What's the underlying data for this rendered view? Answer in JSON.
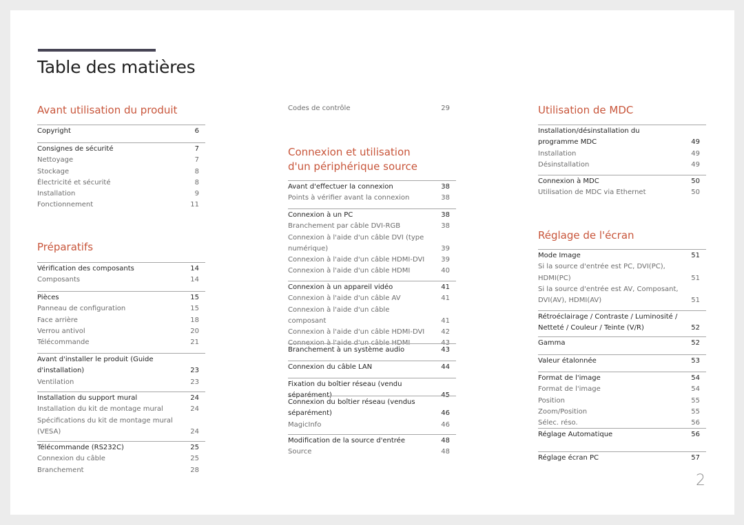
{
  "document": {
    "title": "Table des matières",
    "page_number": "2",
    "colors": {
      "heading": "#c8553a",
      "title_bar": "#464454",
      "main_text": "#1f1f1f",
      "sub_text": "#6b6b6b"
    }
  },
  "columns": [
    {
      "sections": [
        {
          "heading": "Avant utilisation du produit",
          "groups": [
            {
              "entries": [
                {
                  "label": "Copyright",
                  "page": "6",
                  "main": true
                }
              ]
            },
            {
              "entries": [
                {
                  "label": "Consignes de sécurité",
                  "page": "7",
                  "main": true
                },
                {
                  "label": "Nettoyage",
                  "page": "7"
                },
                {
                  "label": "Stockage",
                  "page": "8"
                },
                {
                  "label": "Électricité et sécurité",
                  "page": "8"
                },
                {
                  "label": "Installation",
                  "page": "9"
                },
                {
                  "label": "Fonctionnement",
                  "page": "11"
                }
              ]
            }
          ]
        },
        {
          "heading": "Préparatifs",
          "groups": [
            {
              "entries": [
                {
                  "label": "Vérification des composants",
                  "page": "14",
                  "main": true
                },
                {
                  "label": "Composants",
                  "page": "14"
                }
              ]
            },
            {
              "entries": [
                {
                  "label": "Pièces",
                  "page": "15",
                  "main": true
                },
                {
                  "label": "Panneau de configuration",
                  "page": "15"
                },
                {
                  "label": "Face arrière",
                  "page": "18"
                },
                {
                  "label": "Verrou antivol",
                  "page": "20"
                },
                {
                  "label": "Télécommande",
                  "page": "21"
                }
              ]
            },
            {
              "entries": [
                {
                  "label": "Avant d'installer le produit (Guide d'installation)",
                  "page": "23",
                  "main": true
                },
                {
                  "label": "Ventilation",
                  "page": "23"
                }
              ]
            },
            {
              "entries": [
                {
                  "label": "Installation du support mural",
                  "page": "24",
                  "main": true
                },
                {
                  "label": "Installation du kit de montage mural",
                  "page": "24"
                },
                {
                  "label": "Spécifications du kit de montage mural (VESA)",
                  "page": "24"
                }
              ]
            },
            {
              "entries": [
                {
                  "label": "Télécommande (RS232C)",
                  "page": "25",
                  "main": true
                },
                {
                  "label": "Connexion du câble",
                  "page": "25"
                },
                {
                  "label": "Branchement",
                  "page": "28"
                }
              ]
            }
          ]
        }
      ]
    },
    {
      "sections": [
        {
          "heading": "",
          "groups": [
            {
              "entries": [
                {
                  "label": "Codes de contrôle",
                  "page": "29"
                }
              ]
            }
          ]
        },
        {
          "heading": "Connexion et utilisation\nd'un périphérique source",
          "groups": [
            {
              "entries": [
                {
                  "label": "Avant d'effectuer la connexion",
                  "page": "38",
                  "main": true
                },
                {
                  "label": "Points à vérifier avant la connexion",
                  "page": "38"
                }
              ]
            },
            {
              "entries": [
                {
                  "label": "Connexion à un PC",
                  "page": "38",
                  "main": true
                },
                {
                  "label": "Branchement par câble DVI-RGB",
                  "page": "38"
                },
                {
                  "label": "Connexion à l'aide d'un câble DVI (type numérique)",
                  "page": "39"
                },
                {
                  "label": "Connexion à l'aide d'un câble HDMI-DVI",
                  "page": "39"
                },
                {
                  "label": "Connexion à l'aide d'un câble HDMI",
                  "page": "40"
                }
              ]
            },
            {
              "entries": [
                {
                  "label": "Connexion à un appareil vidéo",
                  "page": "41",
                  "main": true
                },
                {
                  "label": "Connexion à l'aide d'un câble AV",
                  "page": "41"
                },
                {
                  "label": "Connexion à l'aide d'un câble composant",
                  "page": "41"
                },
                {
                  "label": "Connexion à l'aide d'un câble HDMI-DVI",
                  "page": "42"
                },
                {
                  "label": "Connexion à l'aide d'un câble HDMI",
                  "page": "43"
                }
              ]
            },
            {
              "entries": [
                {
                  "label": "Branchement à un système audio",
                  "page": "43",
                  "main": true
                }
              ]
            },
            {
              "entries": [
                {
                  "label": "Connexion du câble LAN",
                  "page": "44",
                  "main": true
                }
              ]
            },
            {
              "entries": [
                {
                  "label": "Fixation du boîtier réseau (vendu séparément)",
                  "page": "45",
                  "main": true
                }
              ]
            },
            {
              "entries": [
                {
                  "label": "Connexion du boîtier réseau (vendus séparément)",
                  "page": "46",
                  "main": true
                },
                {
                  "label": "MagicInfo",
                  "page": "46"
                }
              ]
            },
            {
              "entries": [
                {
                  "label": "Modification de la source d'entrée",
                  "page": "48",
                  "main": true
                },
                {
                  "label": "Source",
                  "page": "48"
                }
              ]
            }
          ]
        }
      ]
    },
    {
      "sections": [
        {
          "heading": "Utilisation de MDC",
          "groups": [
            {
              "entries": [
                {
                  "label": "Installation/désinstallation du programme MDC",
                  "page": "49",
                  "main": true
                },
                {
                  "label": "Installation",
                  "page": "49"
                },
                {
                  "label": "Désinstallation",
                  "page": "49"
                }
              ]
            },
            {
              "entries": [
                {
                  "label": "Connexion à MDC",
                  "page": "50",
                  "main": true
                },
                {
                  "label": "Utilisation de MDC via Ethernet",
                  "page": "50"
                }
              ]
            }
          ]
        },
        {
          "heading": "Réglage de l'écran",
          "groups": [
            {
              "entries": [
                {
                  "label": "Mode Image",
                  "page": "51",
                  "main": true
                },
                {
                  "label": "Si la source d'entrée est PC, DVI(PC), HDMI(PC)",
                  "page": "51"
                },
                {
                  "label": "Si la source d'entrée est AV, Composant, DVI(AV), HDMI(AV)",
                  "page": "51"
                }
              ]
            },
            {
              "entries": [
                {
                  "label": "Rétroéclairage / Contraste / Luminosité / Netteté / Couleur / Teinte (V/R)",
                  "page": "52",
                  "main": true
                }
              ]
            },
            {
              "entries": [
                {
                  "label": "Gamma",
                  "page": "52",
                  "main": true
                }
              ]
            },
            {
              "entries": [
                {
                  "label": "Valeur étalonnée",
                  "page": "53",
                  "main": true
                }
              ]
            },
            {
              "entries": [
                {
                  "label": "Format de l'image",
                  "page": "54",
                  "main": true
                },
                {
                  "label": "Format de l'image",
                  "page": "54"
                },
                {
                  "label": "Position",
                  "page": "55"
                },
                {
                  "label": "Zoom/Position",
                  "page": "55"
                },
                {
                  "label": "Sélec. réso.",
                  "page": "56"
                }
              ]
            },
            {
              "entries": [
                {
                  "label": "Réglage Automatique",
                  "page": "56",
                  "main": true
                }
              ]
            },
            {
              "entries": [
                {
                  "label": "Réglage écran PC",
                  "page": "57",
                  "main": true
                }
              ]
            }
          ]
        }
      ]
    }
  ]
}
